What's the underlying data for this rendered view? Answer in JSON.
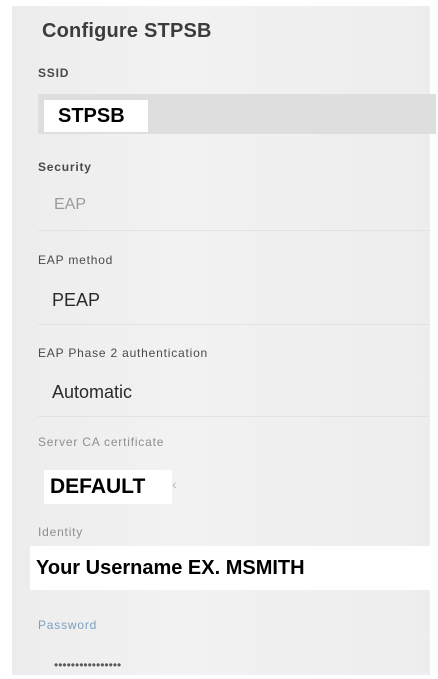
{
  "dialog": {
    "title": "Configure STPSB"
  },
  "fields": {
    "ssid": {
      "label": "SSID",
      "value": "STPSB"
    },
    "security": {
      "label": "Security",
      "value": "EAP"
    },
    "eap_method": {
      "label": "EAP method",
      "value": "PEAP"
    },
    "phase2": {
      "label": "EAP Phase 2 authentication",
      "value": "Automatic"
    },
    "ca_cert": {
      "label": "Server CA certificate",
      "value": "DEFAULT",
      "arrow": "‹"
    },
    "identity": {
      "label": "Identity",
      "value": "Your Username EX. MSMITH"
    },
    "password": {
      "label": "Password",
      "value": "••••••••••••••••"
    }
  }
}
